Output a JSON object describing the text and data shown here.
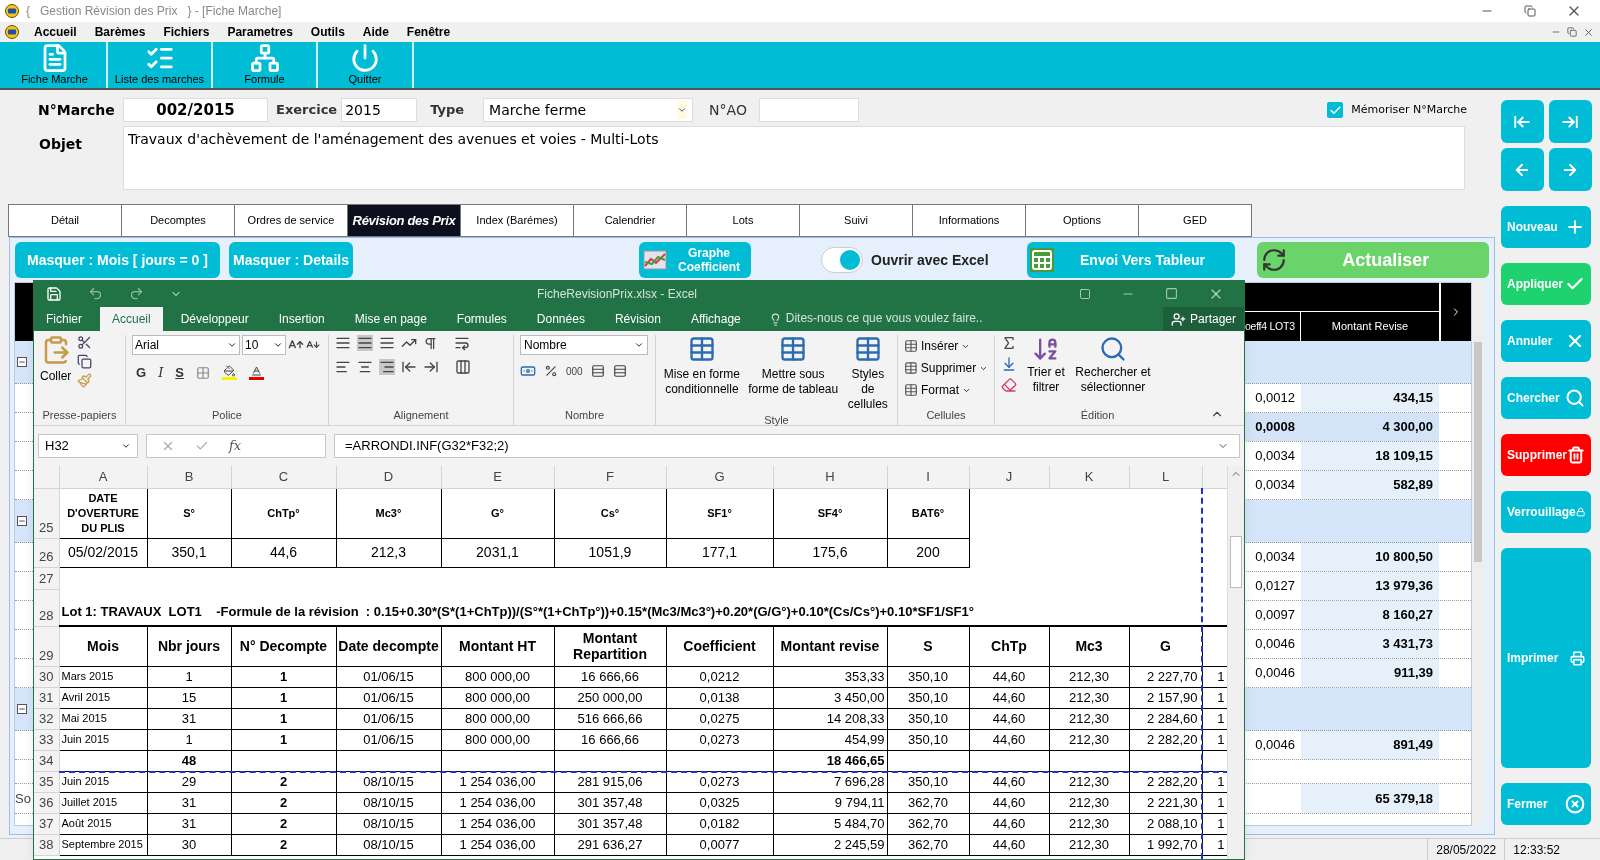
{
  "window": {
    "title": "{   Gestion Révision des Prix   } - [Fiche Marche]"
  },
  "menu": [
    "Accueil",
    "Barèmes",
    "Fichiers",
    "Parametres",
    "Outils",
    "Aide",
    "Fenêtre"
  ],
  "toolbar": [
    {
      "label": "Fiche Marche"
    },
    {
      "label": "Liste des marches"
    },
    {
      "label": "Formule"
    },
    {
      "label": "Quitter"
    }
  ],
  "form": {
    "marche_label": "N°Marche",
    "marche_value": "002/2015",
    "exercice_label": "Exercice",
    "exercice_value": "2015",
    "type_label": "Type",
    "type_value": "Marche ferme",
    "ao_label": "N°AO",
    "memoriser": {
      "label": "Mémoriser N°Marche",
      "checked": true
    },
    "objet_label": "Objet",
    "objet_value": "Travaux d'achèvement de l'aménagement des avenues et voies - Multi-Lots"
  },
  "tabs": [
    {
      "label": "Détail",
      "selected": false
    },
    {
      "label": "Decomptes",
      "selected": false
    },
    {
      "label": "Ordres de service",
      "selected": false
    },
    {
      "label": "Révision des Prix",
      "selected": true
    },
    {
      "label": "Index (Barémes)",
      "selected": false
    },
    {
      "label": "Calendrier",
      "selected": false
    },
    {
      "label": "Lots",
      "selected": false
    },
    {
      "label": "Suivi",
      "selected": false
    },
    {
      "label": "Informations",
      "selected": false
    },
    {
      "label": "Options",
      "selected": false
    },
    {
      "label": "GED",
      "selected": false
    }
  ],
  "panel": {
    "masquer_mois": "Masquer : Mois [ jours = 0 ]",
    "masquer_details": "Masquer : Details",
    "graphe": "Graphe Coefficient",
    "excel_toggle": {
      "label": "Ouvrir avec Excel",
      "on": true
    },
    "envoi": "Envoi Vers Tableur",
    "actualiser": "Actualiser"
  },
  "grid": {
    "columns": [
      "oeff4 LOT3",
      "Montant Revise"
    ],
    "rows": [
      {
        "kind": "group",
        "expanded": true
      },
      {
        "kind": "data",
        "coeff": "0,0012",
        "montant": "434,15",
        "selected": false
      },
      {
        "kind": "data",
        "coeff": "0,0008",
        "montant": "4 300,00",
        "selected": true
      },
      {
        "kind": "data",
        "coeff": "0,0034",
        "montant": "18 109,15",
        "selected": false
      },
      {
        "kind": "data",
        "coeff": "0,0034",
        "montant": "582,89",
        "selected": false
      },
      {
        "kind": "group",
        "expanded": true
      },
      {
        "kind": "data",
        "coeff": "0,0034",
        "montant": "10 800,50",
        "selected": false
      },
      {
        "kind": "data",
        "coeff": "0,0127",
        "montant": "13 979,36",
        "selected": false
      },
      {
        "kind": "data",
        "coeff": "0,0097",
        "montant": "8 160,27",
        "selected": false
      },
      {
        "kind": "data",
        "coeff": "0,0046",
        "montant": "3 431,73",
        "selected": false
      },
      {
        "kind": "data",
        "coeff": "0,0046",
        "montant": "911,39",
        "selected": false
      },
      {
        "kind": "group",
        "expanded": true
      },
      {
        "kind": "data",
        "coeff": "0,0046",
        "montant": "891,49",
        "selected": false
      },
      {
        "kind": "blank"
      }
    ],
    "total": {
      "label": "So",
      "montant": "65 379,18"
    }
  },
  "actions": [
    {
      "label": "Nouveau",
      "color": "#00bcd4"
    },
    {
      "label": "Appliquer",
      "color": "#1ed36f"
    },
    {
      "label": "Annuler",
      "color": "#00bcd4"
    },
    {
      "label": "Chercher",
      "color": "#00bcd4"
    },
    {
      "label": "Supprimer",
      "color": "#ff0000"
    },
    {
      "label": "Verrouillage",
      "color": "#00bcd4"
    },
    {
      "label": "Imprimer",
      "color": "#00bcd4"
    },
    {
      "label": "Fermer",
      "color": "#00bcd4"
    }
  ],
  "excel": {
    "title": "FicheRevisionPrix.xlsx - Excel",
    "tabs": [
      {
        "label": "Fichier",
        "selected": false
      },
      {
        "label": "Accueil",
        "selected": true
      },
      {
        "label": "Développeur",
        "selected": false
      },
      {
        "label": "Insertion",
        "selected": false
      },
      {
        "label": "Mise en page",
        "selected": false
      },
      {
        "label": "Formules",
        "selected": false
      },
      {
        "label": "Données",
        "selected": false
      },
      {
        "label": "Révision",
        "selected": false
      },
      {
        "label": "Affichage",
        "selected": false
      }
    ],
    "tell_me": "Dites-nous ce que vous voulez faire..",
    "share": "Partager",
    "ribbon": {
      "clipboard": {
        "name": "Presse-papiers",
        "paste": "Coller"
      },
      "font": {
        "name": "Police",
        "font": "Arial",
        "size": "10",
        "bold": "G",
        "italic": "I",
        "underline": "S"
      },
      "align": {
        "name": "Alignement"
      },
      "number": {
        "name": "Nombre",
        "format": "Nombre",
        "thousands": "000"
      },
      "style": {
        "name": "Style",
        "buttons": [
          "Mise en forme conditionnelle",
          "Mettre sous forme de tableau",
          "Styles de cellules"
        ]
      },
      "cells": {
        "name": "Cellules",
        "buttons": [
          "Insérer",
          "Supprimer",
          "Format"
        ]
      },
      "edit": {
        "name": "Édition",
        "buttons": [
          "Trier et filtrer",
          "Rechercher et sélectionner"
        ]
      }
    },
    "name_box": "H32",
    "fx": "fx",
    "formula": "=ARRONDI.INF(G32*F32;2)",
    "sheet": {
      "columns": [
        "A",
        "B",
        "C",
        "D",
        "E",
        "F",
        "G",
        "H",
        "I",
        "J",
        "K",
        "L"
      ],
      "rows": [
        {
          "num": "25",
          "kind": "ref_header",
          "cells": [
            "DATE D'OVERTURE DU PLIS",
            "S°",
            "ChTp°",
            "Mc3°",
            "G°",
            "Cs°",
            "SF1°",
            "SF4°",
            "BAT6°"
          ]
        },
        {
          "num": "26",
          "kind": "ref_values",
          "cells": [
            "05/02/2015",
            "350,1",
            "44,6",
            "212,3",
            "2031,1",
            "1051,9",
            "177,1",
            "175,6",
            "200"
          ]
        },
        {
          "num": "27",
          "kind": "blank"
        },
        {
          "num": "28",
          "kind": "title",
          "text": "Lot 1: TRAVAUX  LOT1    -Formule de la révision  : 0.15+0.30*(S*(1+ChTp))/(S°*(1+ChTp°))+0.15*(Mc3/Mc3°)+0.20*(G/G°)+0.10*(Cs/Cs°)+0.10*SF1/SF1°"
        },
        {
          "num": "29",
          "kind": "header",
          "cells": [
            "Mois",
            "Nbr jours",
            "N° Decompte",
            "Date decompte",
            "Montant HT",
            "Montant Repartition",
            "Coefficient",
            "Montant revise",
            "S",
            "ChTp",
            "Mc3",
            "G"
          ]
        },
        {
          "num": "30",
          "kind": "data",
          "cells": [
            "Mars 2015",
            "1",
            "1",
            "01/06/15",
            "800 000,00",
            "16 666,66",
            "0,0212",
            "353,33",
            "350,10",
            "44,60",
            "212,30",
            "2 227,70",
            "1"
          ]
        },
        {
          "num": "31",
          "kind": "data",
          "cells": [
            "Avril 2015",
            "15",
            "1",
            "01/06/15",
            "800 000,00",
            "250 000,00",
            "0,0138",
            "3 450,00",
            "350,10",
            "44,60",
            "212,30",
            "2 157,90",
            "1"
          ]
        },
        {
          "num": "32",
          "kind": "data",
          "cells": [
            "Mai 2015",
            "31",
            "1",
            "01/06/15",
            "800 000,00",
            "516 666,66",
            "0,0275",
            "14 208,33",
            "350,10",
            "44,60",
            "212,30",
            "2 284,60",
            "1"
          ]
        },
        {
          "num": "33",
          "kind": "data",
          "cells": [
            "Juin 2015",
            "1",
            "1",
            "01/06/15",
            "800 000,00",
            "16 666,66",
            "0,0273",
            "454,99",
            "350,10",
            "44,60",
            "212,30",
            "2 282,20",
            "1"
          ]
        },
        {
          "num": "34",
          "kind": "subtotal",
          "jours": "48",
          "montant": "18 466,65"
        },
        {
          "num": "35",
          "kind": "data",
          "cells": [
            "Juin 2015",
            "29",
            "2",
            "08/10/15",
            "1 254 036,00",
            "281 915,06",
            "0,0273",
            "7 696,28",
            "350,10",
            "44,60",
            "212,30",
            "2 282,20",
            "1"
          ]
        },
        {
          "num": "36",
          "kind": "data",
          "cells": [
            "Juillet 2015",
            "31",
            "2",
            "08/10/15",
            "1 254 036,00",
            "301 357,48",
            "0,0325",
            "9 794,11",
            "362,70",
            "44,60",
            "212,30",
            "2 221,30",
            "1"
          ]
        },
        {
          "num": "37",
          "kind": "data",
          "cells": [
            "Août 2015",
            "31",
            "2",
            "08/10/15",
            "1 254 036,00",
            "301 357,48",
            "0,0182",
            "5 484,70",
            "362,70",
            "44,60",
            "212,30",
            "2 088,10",
            "1"
          ]
        },
        {
          "num": "38",
          "kind": "data",
          "cells": [
            "Septembre 2015",
            "30",
            "2",
            "08/10/15",
            "1 254 036,00",
            "291 636,27",
            "0,0077",
            "2 245,59",
            "362,70",
            "44,60",
            "212,30",
            "1 992,70",
            "1"
          ]
        }
      ]
    }
  },
  "status_bar": [
    "28/05/2022",
    "12:33:52"
  ]
}
